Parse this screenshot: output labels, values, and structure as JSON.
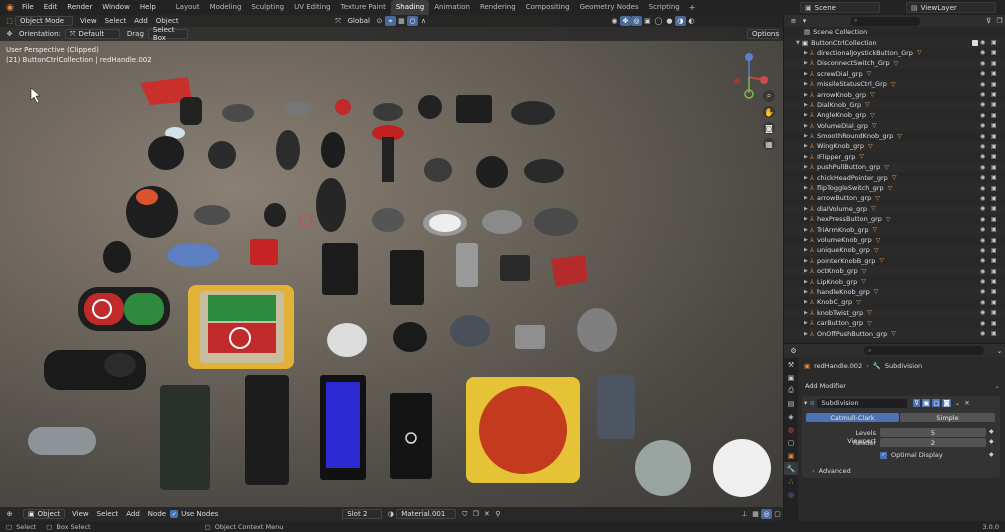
{
  "topbar": {
    "menus": [
      "File",
      "Edit",
      "Render",
      "Window",
      "Help"
    ],
    "workspaces": [
      "Layout",
      "Modeling",
      "Sculpting",
      "UV Editing",
      "Texture Paint",
      "Shading",
      "Animation",
      "Rendering",
      "Compositing",
      "Geometry Nodes",
      "Scripting"
    ],
    "active_workspace": "Shading",
    "add_tab": "+",
    "scene": "Scene",
    "view_layer": "ViewLayer"
  },
  "viewport": {
    "mode": "Object Mode",
    "menus": [
      "View",
      "Select",
      "Add",
      "Object"
    ],
    "transform": "Global",
    "orientation_label": "Orientation:",
    "orientation_value": "Default",
    "drag_label": "Drag",
    "drag_value": "Select Box",
    "options": "Options",
    "info_line1": "User Perspective (Clipped)",
    "info_line2": "(21) ButtonCtrlCollection | redHandle.002"
  },
  "bottombar": {
    "mode": "Object",
    "menus": [
      "View",
      "Select",
      "Add",
      "Node"
    ],
    "use_nodes": "Use Nodes",
    "slot": "Slot 2",
    "material": "Material.001"
  },
  "statusbar": {
    "select": "Select",
    "box_select": "Box Select",
    "context_menu": "Object Context Menu",
    "version": "3.0.0"
  },
  "outliner": {
    "scene_collection": "Scene Collection",
    "root": "ButtonCtrlCollection",
    "items": [
      "directionalJoystickButton_Grp",
      "DisconnectSwitch_Grp",
      "screwDial_grp",
      "missileStatusCtrl_Grp",
      "arrowKnob_grp",
      "DialKnob_Grp",
      "AngleKnob_grp",
      "VolumeDial_grp",
      "SmoothRoundKnob_grp",
      "WingKnob_grp",
      "IFlipper_grp",
      "pushPullButton_grp",
      "chickHeadPointer_grp",
      "flipToggleSwitch_grp",
      "arrowButton_grp",
      "dialVolume_grp",
      "hexPressButton_grp",
      "TriArmKnob_grp",
      "volumeKnob_grp",
      "uniqueKnob_grp",
      "pointerKnobB_grp",
      "octKnob_grp",
      "LipKnob_grp",
      "handleKnob_grp",
      "KnobC_grp",
      "knobTwist_grp",
      "carButton_grp",
      "OnOffPushButton_grp"
    ]
  },
  "properties": {
    "object": "redHandle.002",
    "modifier_tab": "Subdivision",
    "add_modifier": "Add Modifier",
    "modifier_name": "Subdivision",
    "mode_catmull": "Catmull-Clark",
    "mode_simple": "Simple",
    "levels_label": "Levels Viewport",
    "levels_value": "5",
    "render_label": "Render",
    "render_value": "2",
    "optimal_display": "Optimal Display",
    "advanced": "Advanced"
  },
  "colors": {
    "accent": "#4a72b4",
    "orange": "#e8873a",
    "panel": "#282828"
  }
}
